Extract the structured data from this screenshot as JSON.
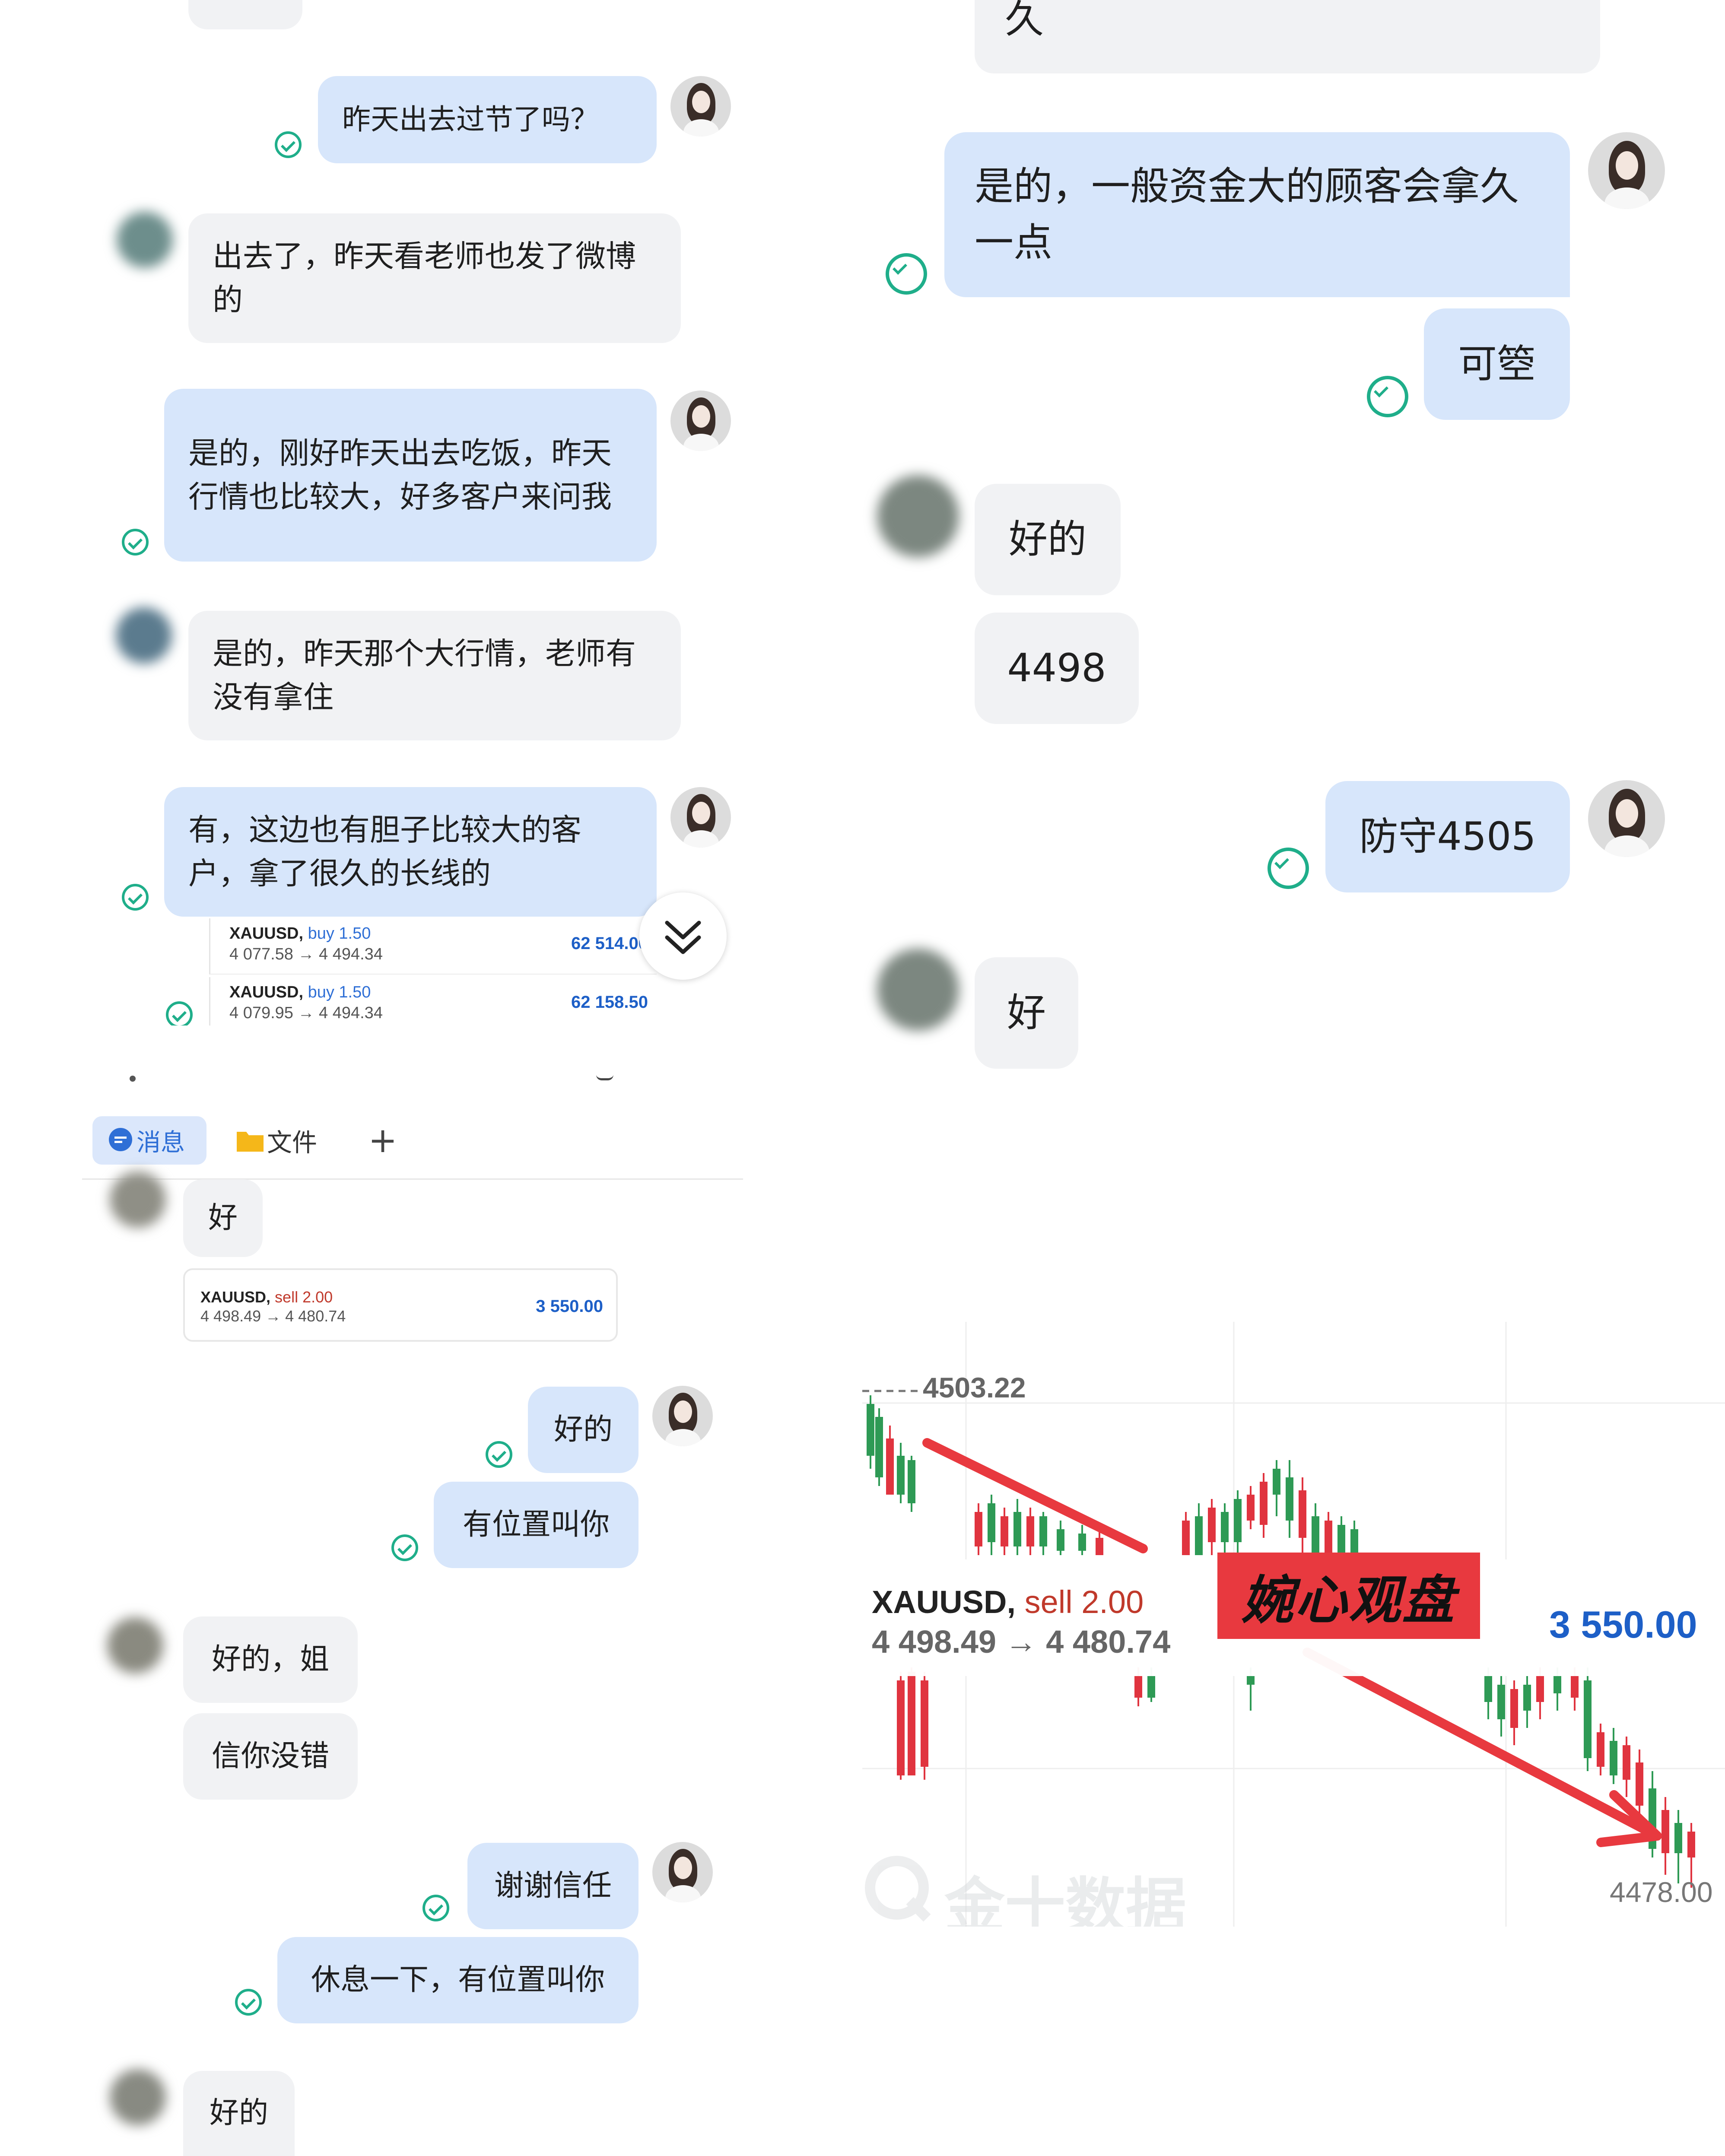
{
  "panel_tl": {
    "top_partial": "",
    "messages": [
      {
        "from": "me",
        "text": "昨天出去过节了吗？"
      },
      {
        "from": "them",
        "text": "出去了，昨天看老师也发了微博的"
      },
      {
        "from": "me",
        "text": "是的，刚好昨天出去吃饭，昨天行情也比较大，好多客户来问我"
      },
      {
        "from": "them",
        "text": "是的，昨天那个大行情，老师有没有拿住"
      },
      {
        "from": "me",
        "text": "有，这边也有胆子比较大的客户，拿了很久的长线的"
      }
    ],
    "trades": [
      {
        "symbol": "XAUUSD,",
        "side": "buy 1.50",
        "prices": "4 077.58 → 4 494.34",
        "profit": "62 514.00"
      },
      {
        "symbol": "XAUUSD,",
        "side": "buy 1.50",
        "prices": "4 079.95 → 4 494.34",
        "profit": "62 158.50"
      }
    ],
    "scroll_down_icon": "double-chevron-down-icon"
  },
  "panel_bl": {
    "tabs": [
      {
        "label": "消息",
        "icon": "message-icon",
        "active": true
      },
      {
        "label": "文件",
        "icon": "folder-icon",
        "active": false
      },
      {
        "label": "+",
        "icon": "plus-icon",
        "active": false
      }
    ],
    "msg_1": "好",
    "trade": {
      "symbol": "XAUUSD,",
      "side": "sell 2.00",
      "prices": "4 498.49 → 4 480.74",
      "profit": "3 550.00"
    },
    "msg_2": "好的",
    "msg_3": "有位置叫你",
    "msg_4": "好的，姐",
    "msg_5": "信你没错",
    "msg_6": "谢谢信任",
    "msg_7": "休息一下，有位置叫你",
    "msg_8": "好的"
  },
  "panel_tr": {
    "msg_0": "久",
    "msg_1": "是的，一般资金大的顾客会拿久一点",
    "msg_2": "可箜",
    "msg_3": "好的",
    "msg_4": "4498",
    "msg_5": "防守4505",
    "msg_6": "好"
  },
  "panel_br": {
    "top_price": "4503.22",
    "bottom_price": "4478.00",
    "trade": {
      "symbol": "XAUUSD,",
      "side": "sell 2.00",
      "prices": "4 498.49 → 4 480.74",
      "profit": "3 550.00"
    },
    "stamp": "婉心观盘",
    "watermark": "金十数据",
    "colors": {
      "up": "#2e9a55",
      "down": "#e0343f",
      "arrow": "#e8393f",
      "stamp_bg": "#e8393f"
    }
  }
}
